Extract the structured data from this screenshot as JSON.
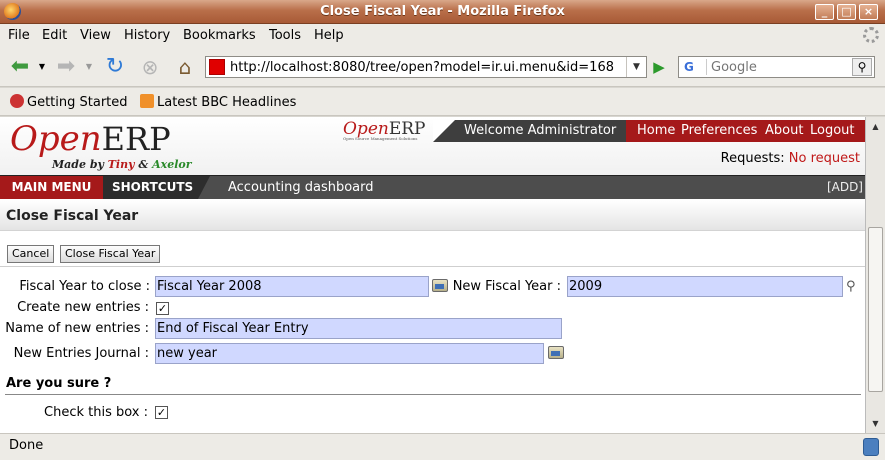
{
  "window": {
    "title": "Close Fiscal Year - Mozilla Firefox"
  },
  "menubar": {
    "items": [
      "File",
      "Edit",
      "View",
      "History",
      "Bookmarks",
      "Tools",
      "Help"
    ]
  },
  "navbar": {
    "url": "http://localhost:8080/tree/open?model=ir.ui.menu&id=168",
    "search_placeholder": "Google",
    "search_engine": "G"
  },
  "bookmarks": {
    "items": [
      "Getting Started",
      "Latest BBC Headlines"
    ]
  },
  "erp": {
    "logo": {
      "open": "Open",
      "erp": "ERP",
      "made_by": "Made by ",
      "tiny": "Tiny",
      "amp": " & ",
      "axelor": "Axelor"
    },
    "mini_logo": {
      "open": "Open",
      "erp": "ERP",
      "tagline": "Open Source Management Solutions"
    },
    "welcome": "Welcome Administrator",
    "top_links": [
      "Home",
      "Preferences",
      "About",
      "Logout"
    ],
    "requests_label": "Requests:",
    "requests_value": "No request",
    "main_menu": "MAIN MENU",
    "shortcuts": "SHORTCUTS",
    "dashboard": "Accounting dashboard",
    "add": "[ADD]",
    "page_title": "Close Fiscal Year"
  },
  "toolbar": {
    "cancel": "Cancel",
    "close": "Close Fiscal Year"
  },
  "form": {
    "fy_close_label": "Fiscal Year to close :",
    "fy_close_value": "Fiscal Year 2008",
    "new_fy_label": "New Fiscal Year :",
    "new_fy_value": "2009",
    "create_entries_label": "Create new entries :",
    "create_entries_checked": true,
    "entries_name_label": "Name of new entries :",
    "entries_name_value": "End of Fiscal Year Entry",
    "journal_label": "New Entries Journal :",
    "journal_value": "new year",
    "section_title": "Are you sure ?",
    "check_label": "Check this box :",
    "check_checked": true
  },
  "status": {
    "text": "Done"
  }
}
